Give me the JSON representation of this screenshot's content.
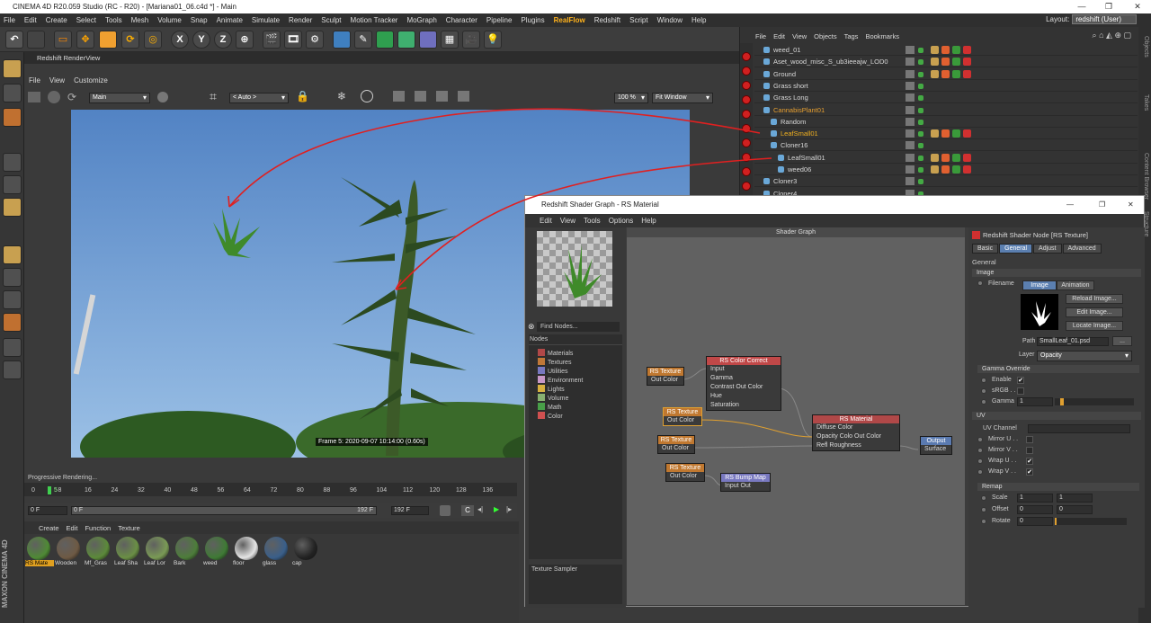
{
  "window": {
    "title": "CINEMA 4D R20.059 Studio (RC - R20) - [Mariana01_06.c4d *] - Main",
    "minimize": "—",
    "maximize": "❐",
    "close": "✕"
  },
  "menu": [
    "File",
    "Edit",
    "Create",
    "Select",
    "Tools",
    "Mesh",
    "Volume",
    "Snap",
    "Animate",
    "Simulate",
    "Render",
    "Sculpt",
    "Motion Tracker",
    "MoGraph",
    "Character",
    "Pipeline",
    "Plugins",
    "RealFlow",
    "Redshift",
    "Script",
    "Window",
    "Help"
  ],
  "menu_highlight": "RealFlow",
  "layout": {
    "label": "Layout:",
    "value": "redshift (User)"
  },
  "toolbar": {
    "x": "X",
    "y": "Y",
    "z": "Z"
  },
  "renderview": {
    "title": "Redshift RenderView",
    "menu": [
      "File",
      "View",
      "Customize"
    ],
    "camera": "Main",
    "aov": "< Auto >",
    "zoom": "100 %",
    "fit": "Fit Window",
    "stamp": "Frame  5:  2020-09-07  10:14:00  (0.60s)"
  },
  "timeline": {
    "status": "Progressive Rendering...",
    "ticks": [
      "0",
      "8",
      "16",
      "24",
      "32",
      "40",
      "48",
      "56",
      "64",
      "72",
      "80",
      "88",
      "96",
      "104",
      "112",
      "120",
      "128",
      "136"
    ],
    "current": "5",
    "start_field": "0 F",
    "slider_start": "0 F",
    "slider_end": "192 F",
    "end_field": "192 F"
  },
  "material_manager": {
    "menu": [
      "Create",
      "Edit",
      "Function",
      "Texture"
    ],
    "materials": [
      {
        "label": "RS Mate",
        "color": "#4f8a35",
        "selected": true
      },
      {
        "label": "Wooden",
        "color": "#6e5a44"
      },
      {
        "label": "Mf_Gras",
        "color": "#5c8a3a"
      },
      {
        "label": "Leaf Sha",
        "color": "#6a8f45"
      },
      {
        "label": "Leaf Lor",
        "color": "#7a9a55"
      },
      {
        "label": "Bark",
        "color": "#4d7d3a"
      },
      {
        "label": "weed",
        "color": "#3f7a35"
      },
      {
        "label": "floor",
        "color": "#e5e5e5"
      },
      {
        "label": "glass",
        "color": "#3a5f8a"
      },
      {
        "label": "cap",
        "color": "#222222"
      }
    ]
  },
  "brand": "MAXON  CINEMA 4D",
  "object_manager": {
    "menu": [
      "File",
      "Edit",
      "View",
      "Objects",
      "Tags",
      "Bookmarks"
    ],
    "rows": [
      {
        "name": "weed_01",
        "indent": 0,
        "color": "#d8d8d8"
      },
      {
        "name": "Aset_wood_misc_S_ub3ieeajw_LOD0",
        "indent": 0,
        "color": "#d8d8d8"
      },
      {
        "name": "Ground",
        "indent": 0,
        "color": "#d8d8d8"
      },
      {
        "name": "Grass short",
        "indent": 0,
        "color": "#d8d8d8"
      },
      {
        "name": "Grass Long",
        "indent": 0,
        "color": "#d8d8d8"
      },
      {
        "name": "CannabisPlant01",
        "indent": 0,
        "color": "#e8a030"
      },
      {
        "name": "Random",
        "indent": 1,
        "color": "#d8d8d8"
      },
      {
        "name": "LeafSmall01",
        "indent": 1,
        "color": "#f0b020"
      },
      {
        "name": "Cloner16",
        "indent": 1,
        "color": "#d8d8d8"
      },
      {
        "name": "LeafSmall01",
        "indent": 2,
        "color": "#d8d8d8"
      },
      {
        "name": "weed06",
        "indent": 2,
        "color": "#d8d8d8"
      },
      {
        "name": "Cloner3",
        "indent": 0,
        "color": "#d8d8d8"
      },
      {
        "name": "Cloner4",
        "indent": 0,
        "color": "#d8d8d8"
      }
    ]
  },
  "side_tabs": [
    "Objects",
    "Takes",
    "Content Browser",
    "Structure"
  ],
  "shader_graph": {
    "title": "Redshift Shader Graph - RS Material",
    "menu": [
      "Edit",
      "View",
      "Tools",
      "Options",
      "Help"
    ],
    "find_placeholder": "Find Nodes...",
    "nodes_header": "Nodes",
    "categories": [
      {
        "label": "Materials",
        "color": "#b04848"
      },
      {
        "label": "Textures",
        "color": "#c07838"
      },
      {
        "label": "Utilities",
        "color": "#7878c0"
      },
      {
        "label": "Environment",
        "color": "#c898c8"
      },
      {
        "label": "Lights",
        "color": "#d8b040"
      },
      {
        "label": "Volume",
        "color": "#88b070"
      },
      {
        "label": "Math",
        "color": "#48a048"
      },
      {
        "label": "Color",
        "color": "#d05050"
      }
    ],
    "description": "Texture Sampler",
    "canvas_title": "Shader Graph",
    "graph_nodes": {
      "tex1": {
        "title": "RS Texture",
        "out": "Out Color"
      },
      "cc": {
        "title": "RS Color Correct",
        "ports": [
          "Input",
          "Gamma",
          "Contrast  Out Color",
          "Hue",
          "Saturation"
        ]
      },
      "tex2": {
        "title": "RS Texture",
        "out": "Out Color"
      },
      "tex3": {
        "title": "RS Texture",
        "out": "Out Color"
      },
      "tex4": {
        "title": "RS Texture",
        "out": "Out Color"
      },
      "mat": {
        "title": "RS Material",
        "ports": [
          "Diffuse Color",
          "Opacity Colo  Out Color",
          "Refl Roughness"
        ]
      },
      "bump": {
        "title": "RS Bump Map",
        "ports": [
          "Input  Out"
        ]
      },
      "output": {
        "title": "Output",
        "ports": [
          "Surface"
        ]
      }
    },
    "attributes": {
      "header": "Redshift Shader Node [RS Texture]",
      "tabs": [
        "Basic",
        "General",
        "Adjust",
        "Advanced"
      ],
      "active_tab": "General",
      "section": "General",
      "image_group": "Image",
      "filename_label": "Filename",
      "subtabs": [
        "Image",
        "Animation"
      ],
      "buttons": [
        "Reload Image...",
        "Edit Image...",
        "Locate Image..."
      ],
      "path_label": "Path",
      "path": "SmallLeaf_01.psd",
      "path_btn": "...",
      "layer_label": "Layer",
      "layer": "Opacity",
      "gamma_group": "Gamma Override",
      "enable_label": "Enable",
      "srgb_label": "sRGB . .",
      "gamma_label": "Gamma",
      "gamma_value": "1",
      "uv_group": "UV",
      "uv_channel_label": "UV Channel",
      "mirror_u": "Mirror U . .",
      "mirror_v": "Mirror V . .",
      "wrap_u": "Wrap U . .",
      "wrap_v": "Wrap V . .",
      "remap_group": "Remap",
      "scale_label": "Scale",
      "scale": [
        "1",
        "1"
      ],
      "offset_label": "Offset",
      "offset": [
        "0",
        "0"
      ],
      "rotate_label": "Rotate",
      "rotate": "0",
      "check": "✔"
    }
  }
}
